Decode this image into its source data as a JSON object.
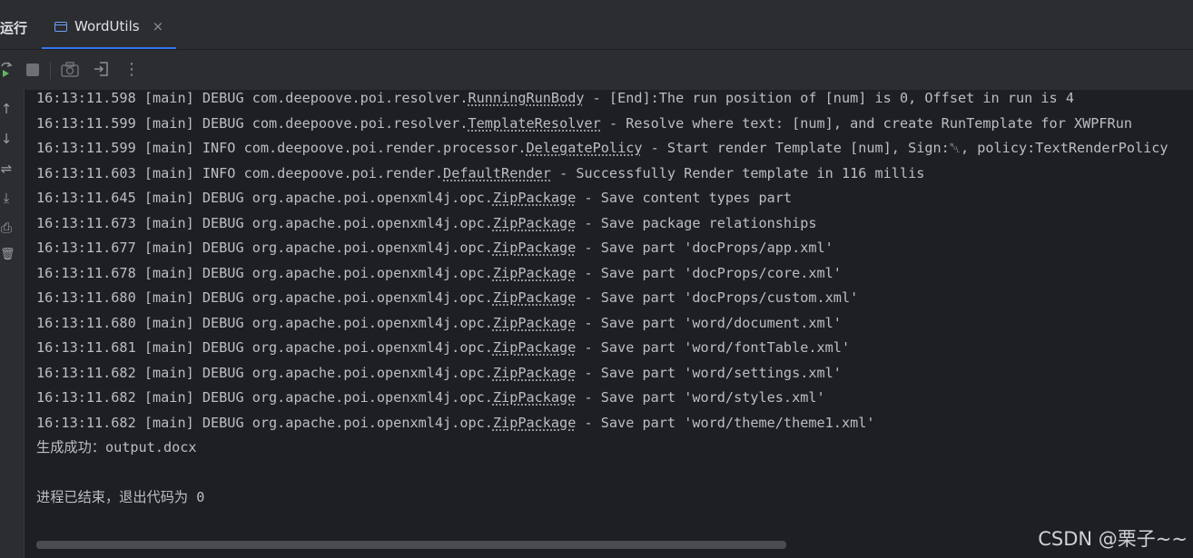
{
  "run_label": "运行",
  "tab": {
    "label": "WordUtils",
    "close": "×"
  },
  "toolbar": {
    "rerun_icon": "rerun-icon",
    "stop_icon": "stop-icon",
    "screenshot_icon": "camera-icon",
    "exit_icon": "exit-icon",
    "more": "⋮"
  },
  "sidebar": {
    "up": "↑",
    "down": "↓",
    "wrap": "⇌",
    "scroll_end": "⤓",
    "print": "⎙",
    "clear": "🗑"
  },
  "log": [
    {
      "pre": "16:13:11.598 [main] DEBUG com.deepoove.poi.resolver.",
      "cls": "RunningRunBody",
      "post": " - [End]:The run position of [num] is 0, Offset in run is 4"
    },
    {
      "pre": "16:13:11.599 [main] DEBUG com.deepoove.poi.resolver.",
      "cls": "TemplateResolver",
      "post": " - Resolve where text: [num], and create RunTemplate for XWPFRun"
    },
    {
      "pre": "16:13:11.599 [main] INFO com.deepoove.poi.render.processor.",
      "cls": "DelegatePolicy",
      "post": " - Start render Template [num], Sign:␀, policy:TextRenderPolicy"
    },
    {
      "pre": "16:13:11.603 [main] INFO com.deepoove.poi.render.",
      "cls": "DefaultRender",
      "post": " - Successfully Render template in 116 millis"
    },
    {
      "pre": "16:13:11.645 [main] DEBUG org.apache.poi.openxml4j.opc.",
      "cls": "ZipPackage",
      "post": " - Save content types part"
    },
    {
      "pre": "16:13:11.673 [main] DEBUG org.apache.poi.openxml4j.opc.",
      "cls": "ZipPackage",
      "post": " - Save package relationships"
    },
    {
      "pre": "16:13:11.677 [main] DEBUG org.apache.poi.openxml4j.opc.",
      "cls": "ZipPackage",
      "post": " - Save part 'docProps/app.xml'"
    },
    {
      "pre": "16:13:11.678 [main] DEBUG org.apache.poi.openxml4j.opc.",
      "cls": "ZipPackage",
      "post": " - Save part 'docProps/core.xml'"
    },
    {
      "pre": "16:13:11.680 [main] DEBUG org.apache.poi.openxml4j.opc.",
      "cls": "ZipPackage",
      "post": " - Save part 'docProps/custom.xml'"
    },
    {
      "pre": "16:13:11.680 [main] DEBUG org.apache.poi.openxml4j.opc.",
      "cls": "ZipPackage",
      "post": " - Save part 'word/document.xml'"
    },
    {
      "pre": "16:13:11.681 [main] DEBUG org.apache.poi.openxml4j.opc.",
      "cls": "ZipPackage",
      "post": " - Save part 'word/fontTable.xml'"
    },
    {
      "pre": "16:13:11.682 [main] DEBUG org.apache.poi.openxml4j.opc.",
      "cls": "ZipPackage",
      "post": " - Save part 'word/settings.xml'"
    },
    {
      "pre": "16:13:11.682 [main] DEBUG org.apache.poi.openxml4j.opc.",
      "cls": "ZipPackage",
      "post": " - Save part 'word/styles.xml'"
    },
    {
      "pre": "16:13:11.682 [main] DEBUG org.apache.poi.openxml4j.opc.",
      "cls": "ZipPackage",
      "post": " - Save part 'word/theme/theme1.xml'"
    }
  ],
  "result_line": "生成成功：output.docx",
  "exit_line": "进程已结束，退出代码为 0",
  "watermark": "CSDN @栗子~~"
}
